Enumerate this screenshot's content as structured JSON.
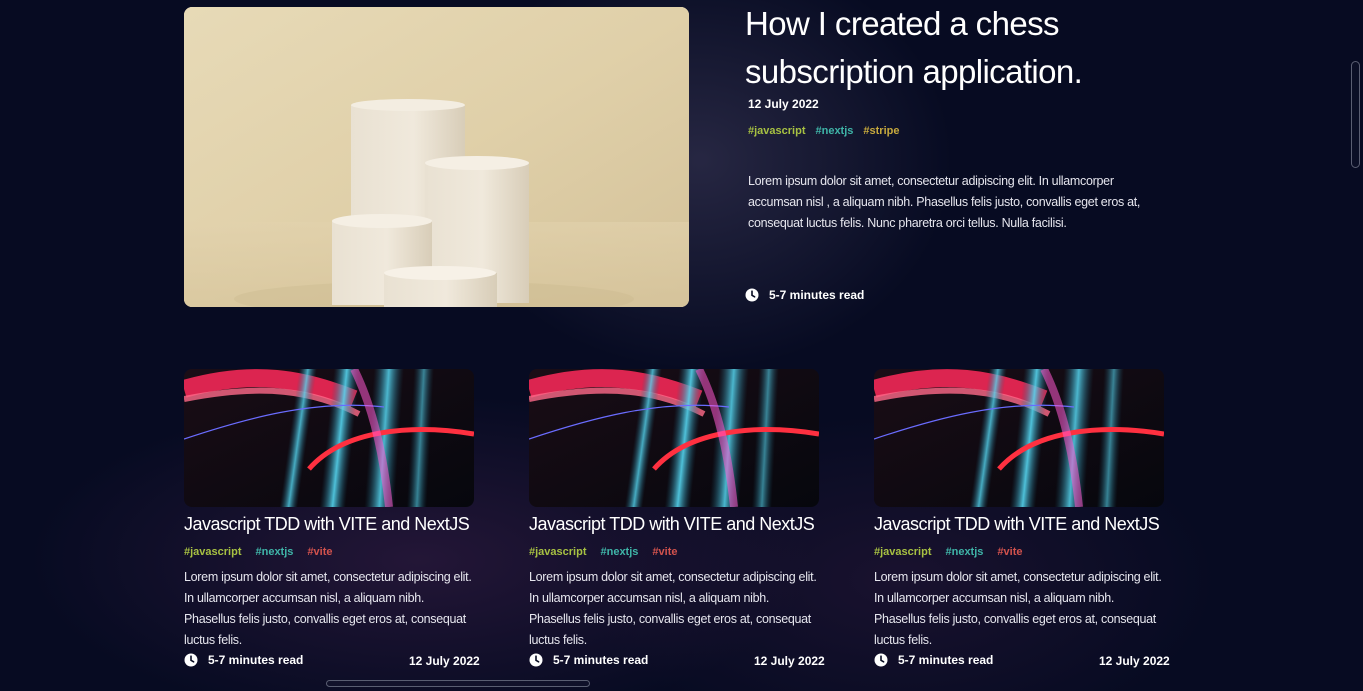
{
  "featured": {
    "title": "How I created a chess subscription application.",
    "date": "12 July 2022",
    "tags": [
      "#javascript",
      "#nextjs",
      "#stripe"
    ],
    "description": "Lorem ipsum dolor sit amet, consectetur adipiscing elit. In ullamcorper accumsan nisl , a aliquam nibh. Phasellus felis justo, convallis eget eros at, consequat luctus felis. Nunc pharetra orci tellus. Nulla facilisi.",
    "read_time": "5-7 minutes read",
    "image": "cream-cylinder-podiums-photo",
    "icon": "clock-icon"
  },
  "cards": [
    {
      "title": "Javascript TDD with VITE and NextJS",
      "tags": [
        "#javascript",
        "#nextjs",
        "#vite"
      ],
      "description": "Lorem ipsum dolor sit amet, consectetur adipiscing elit. In ullamcorper accumsan nisl, a aliquam nibh. Phasellus felis justo, convallis eget eros at, consequat luctus felis.",
      "read_time": "5-7 minutes read",
      "date": "12 July 2022",
      "image": "neon-light-trails-photo"
    },
    {
      "title": "Javascript TDD with VITE and NextJS",
      "tags": [
        "#javascript",
        "#nextjs",
        "#vite"
      ],
      "description": "Lorem ipsum dolor sit amet, consectetur adipiscing elit. In ullamcorper accumsan nisl, a aliquam nibh. Phasellus felis justo, convallis eget eros at, consequat luctus felis.",
      "read_time": "5-7 minutes read",
      "date": "12 July 2022",
      "image": "neon-light-trails-photo"
    },
    {
      "title": "Javascript TDD with VITE and NextJS",
      "tags": [
        "#javascript",
        "#nextjs",
        "#vite"
      ],
      "description": "Lorem ipsum dolor sit amet, consectetur adipiscing elit. In ullamcorper accumsan nisl, a aliquam nibh. Phasellus felis justo, convallis eget eros at, consequat luctus felis.",
      "read_time": "5-7 minutes read",
      "date": "12 July 2022",
      "image": "neon-light-trails-photo"
    }
  ],
  "colors": {
    "background": "#070b22",
    "tag_javascript": "#a7c142",
    "tag_nextjs": "#3fb5a8",
    "tag_stripe": "#c7a93d",
    "tag_vite": "#d2524d"
  }
}
